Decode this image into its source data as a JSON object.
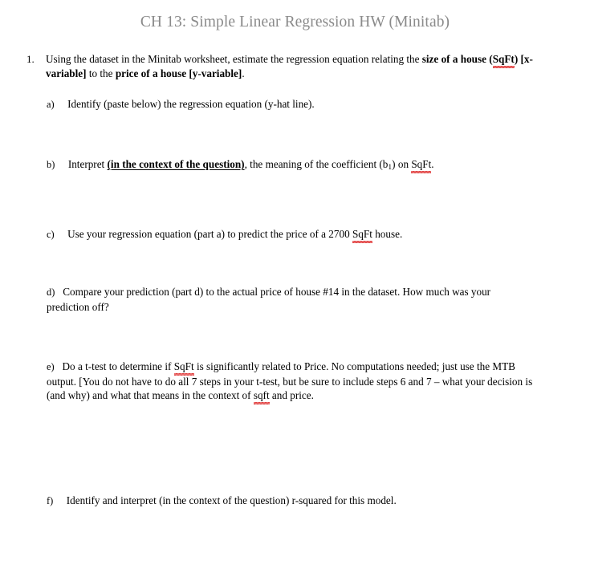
{
  "document": {
    "title": "CH 13: Simple Linear Regression HW (Minitab)",
    "title_color": "#8a8a8a",
    "background_color": "#ffffff",
    "body_text_color": "#000000",
    "spellcheck_underline_color": "#e03030"
  },
  "question_1": {
    "marker": "1.",
    "line1_part1": "Using the dataset in the Minitab worksheet, estimate the regression equation relating the ",
    "line1_bold_tail": "size",
    "line2_bold_of_a_house": "of a house (",
    "line2_bold_sqft": "SqFt",
    "line2_bold_after_sqft": ") [x-variable]",
    "line2_plain_to_the": " to the ",
    "line2_bold_price": "price of a house [y-variable]",
    "line2_period": "."
  },
  "subitems": {
    "a": {
      "marker": "a)",
      "text": "Identify (paste below) the regression equation (y-hat line)."
    },
    "b": {
      "marker": "b)",
      "text_before": "Interpret ",
      "underlined_bold": "(in the context of the question)",
      "text_mid": ", the meaning of the coefficient (b",
      "subscript": "1",
      "text_after": ") on ",
      "spellchecked_word": "SqFt",
      "text_end": "."
    },
    "c": {
      "marker": "c)",
      "text_before": "Use your regression equation (part a) to predict the price of a 2700 ",
      "spellchecked_word": "SqFt",
      "text_after": " house."
    },
    "d": {
      "marker": "d)",
      "text": "Compare your prediction (part d) to the actual price of house #14 in the dataset. How much was your prediction off?"
    },
    "e": {
      "marker": "e)",
      "text_part1": "Do a t-test to determine if ",
      "spellchecked_word_1": "SqFt",
      "text_part2": " is significantly related to Price. No computations needed; just use the MTB output. [You do not have to do all 7 steps in your t-test, but be sure to include steps 6 and 7 – what your decision is (and why) and what that means in the context of ",
      "spellchecked_word_2": "sqft",
      "text_part3": " and price."
    },
    "f": {
      "marker": "f)",
      "text": "Identify and interpret (in the context of the question) r-squared for this model."
    }
  }
}
